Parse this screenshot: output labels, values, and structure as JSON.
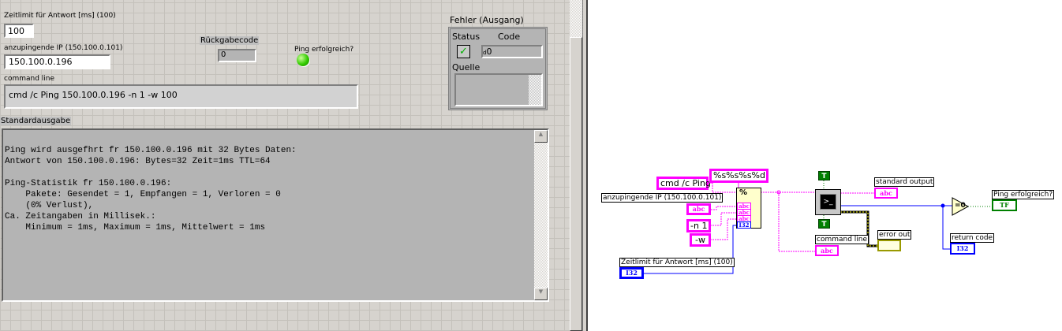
{
  "front_panel": {
    "timeout": {
      "label": "Zeitlimit für Antwort [ms] (100)",
      "value": "100"
    },
    "ip": {
      "label": "anzupingende IP (150.100.0.101)",
      "value": "150.100.0.196"
    },
    "command_line": {
      "label": "command line",
      "value": "cmd /c Ping 150.100.0.196 -n 1 -w 100"
    },
    "return_code": {
      "label": "Rückgabecode",
      "value": "0"
    },
    "ping_ok": {
      "label": "Ping erfolgreich?",
      "state": true,
      "color": "#33cc00"
    },
    "error_out": {
      "label": "Fehler (Ausgang)",
      "status_label": "Status",
      "code_label": "Code",
      "code_prefix": "d",
      "code_value": "0",
      "source_label": "Quelle",
      "status": "ok-check"
    },
    "stdout": {
      "label": "Standardausgabe",
      "lines": [
        "",
        "Ping wird ausgefhrt fr 150.100.0.196 mit 32 Bytes Daten:",
        "Antwort von 150.100.0.196: Bytes=32 Zeit=1ms TTL=64",
        "",
        "Ping-Statistik fr 150.100.0.196:",
        "    Pakete: Gesendet = 1, Empfangen = 1, Verloren = 0",
        "    (0% Verlust),",
        "Ca. Zeitangaben in Millisek.:",
        "    Minimum = 1ms, Maximum = 1ms, Mittelwert = 1ms"
      ]
    }
  },
  "diagram": {
    "const_cmd": "cmd /c Ping",
    "const_format": "%s%s%s%d",
    "const_n": "-n 1",
    "const_w": "-w",
    "ip_label": "anzupingende IP (150.100.0.101)",
    "timeout_label": "Zeitlimit für Antwort [ms] (100)",
    "stdout_label": "standard output",
    "cmdline_label": "command line",
    "error_label": "error out",
    "return_label": "return code",
    "ping_label": "Ping erfolgreich?",
    "true_const": "T",
    "abc": "abc",
    "i32": "I32",
    "tf": "TF",
    "eq0": "=0",
    "fmt_icon": "%",
    "exec_icon": ">_",
    "wire_colors": {
      "string": "#ff00ff",
      "int": "#0000ff",
      "bool": "#008000",
      "error": "#999900"
    }
  }
}
